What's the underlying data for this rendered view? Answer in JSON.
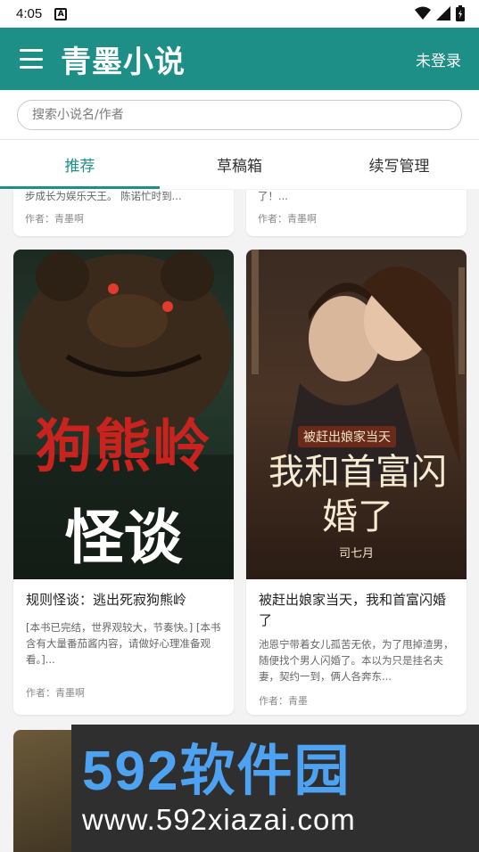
{
  "status_bar": {
    "time": "4:05",
    "notif_icon": "A"
  },
  "app_bar": {
    "title": "青墨小说",
    "login_label": "未登录"
  },
  "search": {
    "placeholder": "搜索小说名/作者",
    "value": ""
  },
  "tabs": [
    {
      "label": "推荐",
      "active": true
    },
    {
      "label": "草稿箱",
      "active": false
    },
    {
      "label": "续写管理",
      "active": false
    }
  ],
  "partial_top_cards": [
    {
      "desc_tail": "步成长为娱乐天王。      陈诺忙时到...",
      "author": "作者：青墨啊"
    },
    {
      "desc_tail": "了！...",
      "author": "作者：青墨啊"
    }
  ],
  "books": [
    {
      "cover_text_main": "狗熊岭",
      "cover_text_sub": "怪谈",
      "title": "规则怪谈：逃出死寂狗熊岭",
      "desc": "[本书已完结，世界观较大，节奏快。] [本书含有大量番茄酱内容，请做好心理准备观看。]...",
      "author": "作者：青墨啊"
    },
    {
      "cover_text_top": "被赶出娘家当天",
      "cover_text_main": "我和首富闪婚了",
      "cover_text_author": "司七月",
      "title": "被赶出娘家当天，我和首富闪婚了",
      "desc": "池恩宁带着女儿孤苦无依，为了甩掉渣男，随便找个男人闪婚了。本以为只是挂名夫妻，契约一到，俩人各奔东...",
      "author": "作者：青墨"
    }
  ],
  "watermark": {
    "brand": "592软件园",
    "url": "www.592xiazai.com"
  },
  "colors": {
    "accent": "#1d8f87",
    "watermark_blue": "#4da3f2"
  }
}
